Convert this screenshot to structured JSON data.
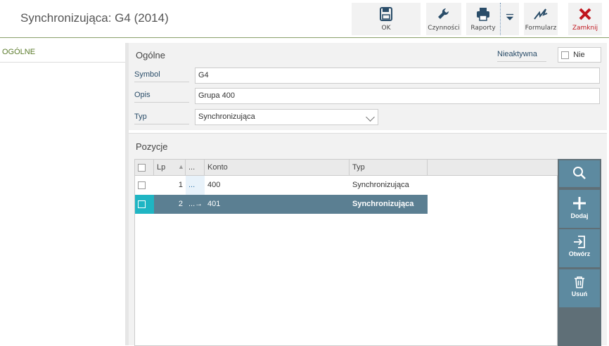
{
  "header": {
    "title": "Synchronizująca: G4 (2014)",
    "toolbar": {
      "ok": "OK",
      "czynnosci": "Czynności",
      "raporty": "Raporty",
      "formularz": "Formularz",
      "zamknij": "Zamknij"
    }
  },
  "nav": {
    "items": [
      {
        "label": "OGÓLNE"
      }
    ]
  },
  "general": {
    "title": "Ogólne",
    "inactive_label": "Nieaktywna",
    "inactive_value": "Nie",
    "fields": {
      "symbol_label": "Symbol",
      "symbol_value": "G4",
      "opis_label": "Opis",
      "opis_value": "Grupa 400",
      "typ_label": "Typ",
      "typ_value": "Synchronizująca"
    }
  },
  "positions": {
    "title": "Pozycje",
    "columns": {
      "lp": "Lp",
      "dots": "...",
      "konto": "Konto",
      "typ": "Typ"
    },
    "rows": [
      {
        "lp": "1",
        "dots": "...",
        "konto": "400",
        "typ": "Synchronizująca",
        "selected": false
      },
      {
        "lp": "2",
        "dots": "...",
        "konto": "401",
        "typ": "Synchronizująca",
        "selected": true
      }
    ],
    "actions": {
      "dodaj": "Dodaj",
      "otworz": "Otwórz",
      "usun": "Usuń"
    }
  },
  "colors": {
    "accent": "#5b7f92",
    "close": "#c0161e",
    "nav_green": "#5a7a2a",
    "check_cyan": "#1fb5c3"
  }
}
